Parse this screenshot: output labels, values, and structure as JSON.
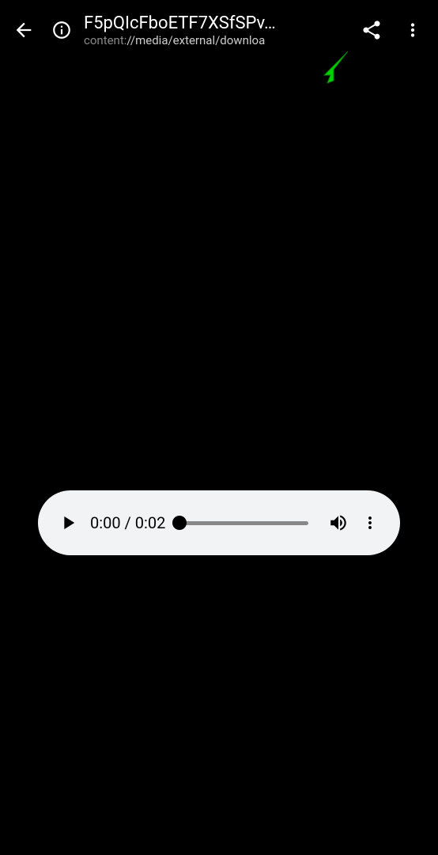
{
  "header": {
    "title": "F5pQIcFboETF7XSfSPv…",
    "subtitle_scheme": "content:",
    "subtitle_path": "//media/external/downloa"
  },
  "player": {
    "current_time": "0:00",
    "separator": " / ",
    "duration": "0:02",
    "progress_percent": 0
  },
  "colors": {
    "cursor": "#00d000"
  }
}
